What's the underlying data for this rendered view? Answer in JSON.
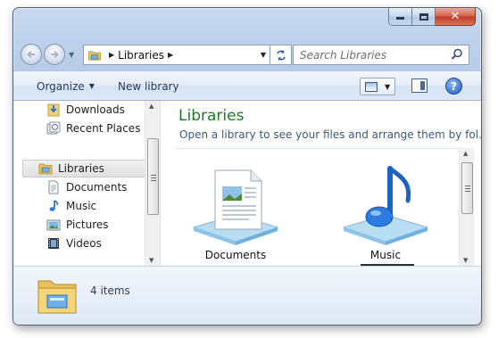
{
  "window": {
    "caption_buttons": {
      "minimize_icon": "minimize-icon",
      "maximize_icon": "maximize-icon",
      "close_glyph": "✕"
    }
  },
  "navigation": {
    "back_icon": "back-arrow-icon",
    "forward_icon": "forward-arrow-icon",
    "address": {
      "segments": [
        "Libraries"
      ]
    },
    "refresh_icon": "refresh-icon",
    "search": {
      "placeholder": "Search Libraries",
      "icon": "search-icon"
    }
  },
  "toolbar": {
    "organize_label": "Organize",
    "new_library_label": "New library",
    "view_icon": "view-options-icon",
    "preview_icon": "preview-pane-icon",
    "help_glyph": "?"
  },
  "sidebar": {
    "items": [
      {
        "label": "Downloads",
        "icon": "downloads-icon",
        "selected": false
      },
      {
        "label": "Recent Places",
        "icon": "recent-places-icon",
        "selected": false
      },
      {
        "label": "Libraries",
        "icon": "libraries-icon",
        "selected": true
      },
      {
        "label": "Documents",
        "icon": "documents-icon",
        "selected": false
      },
      {
        "label": "Music",
        "icon": "music-icon",
        "selected": false
      },
      {
        "label": "Pictures",
        "icon": "pictures-icon",
        "selected": false
      },
      {
        "label": "Videos",
        "icon": "videos-icon",
        "selected": false
      }
    ]
  },
  "main": {
    "title": "Libraries",
    "subtitle": "Open a library to see your files and arrange them by fol...",
    "tiles": [
      {
        "label": "Documents",
        "icon": "documents-library-icon"
      },
      {
        "label": "Music",
        "icon": "music-library-icon"
      }
    ]
  },
  "details": {
    "count_text": "4 items",
    "icon": "libraries-folder-icon"
  },
  "colors": {
    "accent_title": "#1e7a28",
    "window_frame": "#bcd1ea",
    "close_button": "#c13a22"
  }
}
